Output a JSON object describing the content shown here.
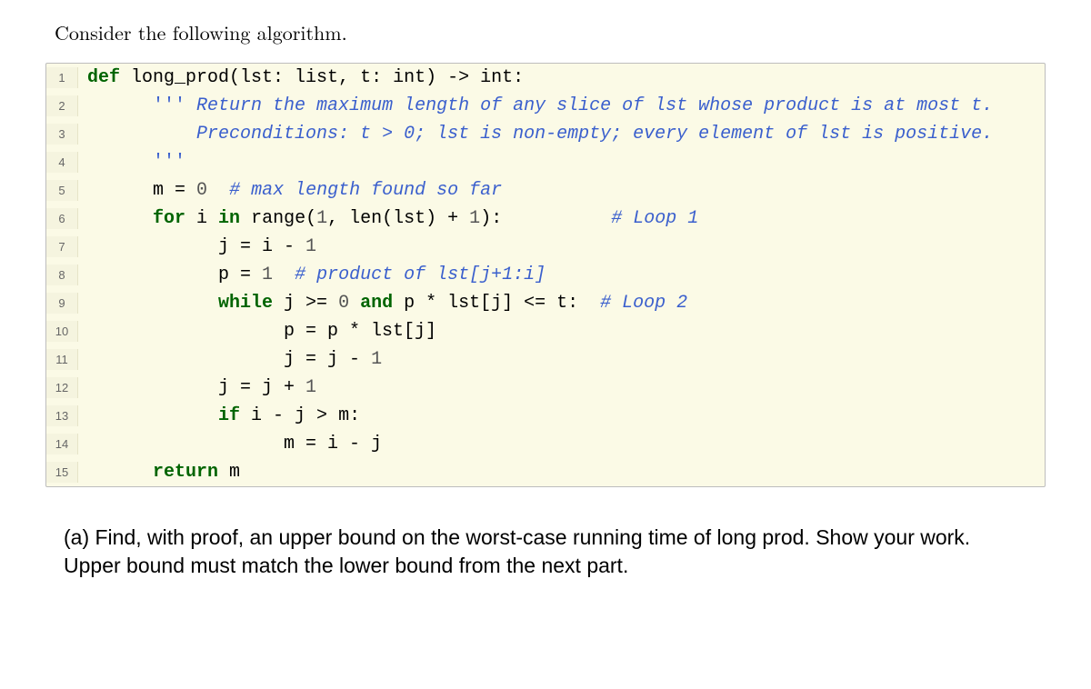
{
  "intro": "Consider the following algorithm.",
  "code": {
    "lines": [
      {
        "n": "1",
        "seg": [
          {
            "c": "kw",
            "t": "def "
          },
          {
            "c": "",
            "t": "long_prod(lst: "
          },
          {
            "c": "bi",
            "t": "list"
          },
          {
            "c": "",
            "t": ", t: "
          },
          {
            "c": "bi",
            "t": "int"
          },
          {
            "c": "",
            "t": ") -> "
          },
          {
            "c": "bi",
            "t": "int"
          },
          {
            "c": "",
            "t": ":"
          }
        ]
      },
      {
        "n": "2",
        "seg": [
          {
            "c": "",
            "t": "      "
          },
          {
            "c": "st",
            "t": "'''"
          },
          {
            "c": "cm",
            "t": " Return the maximum length of any slice of lst whose product is at most t."
          }
        ]
      },
      {
        "n": "3",
        "seg": [
          {
            "c": "",
            "t": "          "
          },
          {
            "c": "cm",
            "t": "Preconditions: t > 0; lst is non-empty; every element of lst is positive."
          }
        ]
      },
      {
        "n": "4",
        "seg": [
          {
            "c": "",
            "t": "      "
          },
          {
            "c": "st",
            "t": "'''"
          }
        ]
      },
      {
        "n": "5",
        "seg": [
          {
            "c": "",
            "t": "      m = "
          },
          {
            "c": "num",
            "t": "0"
          },
          {
            "c": "",
            "t": "  "
          },
          {
            "c": "cm",
            "t": "# max length found so far"
          }
        ]
      },
      {
        "n": "6",
        "seg": [
          {
            "c": "",
            "t": "      "
          },
          {
            "c": "kw",
            "t": "for"
          },
          {
            "c": "",
            "t": " i "
          },
          {
            "c": "kw",
            "t": "in"
          },
          {
            "c": "",
            "t": " "
          },
          {
            "c": "bi",
            "t": "range"
          },
          {
            "c": "",
            "t": "("
          },
          {
            "c": "num",
            "t": "1"
          },
          {
            "c": "",
            "t": ", "
          },
          {
            "c": "bi",
            "t": "len"
          },
          {
            "c": "",
            "t": "(lst) + "
          },
          {
            "c": "num",
            "t": "1"
          },
          {
            "c": "",
            "t": "):          "
          },
          {
            "c": "cm",
            "t": "# Loop 1"
          }
        ]
      },
      {
        "n": "7",
        "seg": [
          {
            "c": "",
            "t": "            j = i - "
          },
          {
            "c": "num",
            "t": "1"
          }
        ]
      },
      {
        "n": "8",
        "seg": [
          {
            "c": "",
            "t": "            p = "
          },
          {
            "c": "num",
            "t": "1"
          },
          {
            "c": "",
            "t": "  "
          },
          {
            "c": "cm",
            "t": "# product of lst[j+1:i]"
          }
        ]
      },
      {
        "n": "9",
        "seg": [
          {
            "c": "",
            "t": "            "
          },
          {
            "c": "kw",
            "t": "while"
          },
          {
            "c": "",
            "t": " j >= "
          },
          {
            "c": "num",
            "t": "0"
          },
          {
            "c": "",
            "t": " "
          },
          {
            "c": "kw",
            "t": "and"
          },
          {
            "c": "",
            "t": " p * lst[j] <= t:  "
          },
          {
            "c": "cm",
            "t": "# Loop 2"
          }
        ]
      },
      {
        "n": "10",
        "seg": [
          {
            "c": "",
            "t": "                  p = p * lst[j]"
          }
        ]
      },
      {
        "n": "11",
        "seg": [
          {
            "c": "",
            "t": "                  j = j - "
          },
          {
            "c": "num",
            "t": "1"
          }
        ]
      },
      {
        "n": "12",
        "seg": [
          {
            "c": "",
            "t": "            j = j + "
          },
          {
            "c": "num",
            "t": "1"
          }
        ]
      },
      {
        "n": "13",
        "seg": [
          {
            "c": "",
            "t": "            "
          },
          {
            "c": "kw",
            "t": "if"
          },
          {
            "c": "",
            "t": " i - j > m:"
          }
        ]
      },
      {
        "n": "14",
        "seg": [
          {
            "c": "",
            "t": "                  m = i - j"
          }
        ]
      },
      {
        "n": "15",
        "seg": [
          {
            "c": "",
            "t": "      "
          },
          {
            "c": "kw",
            "t": "return"
          },
          {
            "c": "",
            "t": " m"
          }
        ]
      }
    ]
  },
  "question": "(a) Find, with proof, an upper bound on the worst-case running time of long prod. Show your work. Upper bound must match the lower bound from the next part."
}
